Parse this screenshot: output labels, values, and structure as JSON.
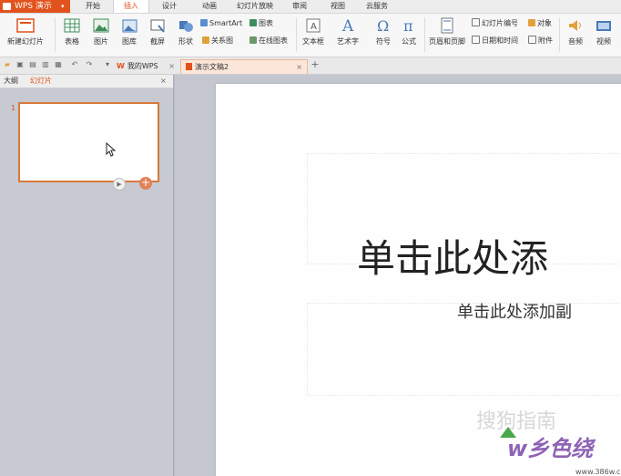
{
  "app": {
    "name": "WPS 演示"
  },
  "menu": [
    "开始",
    "插入",
    "设计",
    "动画",
    "幻灯片放映",
    "审阅",
    "视图",
    "云服务"
  ],
  "menu_active": "插入",
  "ribbon": {
    "new_slide": "新建幻灯片",
    "table": "表格",
    "picture": "图片",
    "gallery": "图库",
    "screenshot": "截屏",
    "shape": "形状",
    "smartart": "SmartArt",
    "chart": "图表",
    "relation": "关系图",
    "online_chart": "在线图表",
    "textbox": "文本框",
    "wordart": "艺术字",
    "symbol": "符号",
    "formula": "公式",
    "header_footer": "页眉和页脚",
    "slide_number": "幻灯片编号",
    "object": "对象",
    "datetime": "日期和时间",
    "attachment": "附件",
    "audio": "音频",
    "video": "视频"
  },
  "tabs": {
    "my_wps": "我的WPS",
    "doc": "演示文稿2"
  },
  "panel": {
    "outline_tab": "大纲",
    "slides_tab": "幻灯片",
    "thumb_number": "1"
  },
  "slide": {
    "title": "单击此处添",
    "subtitle": "单击此处添加副"
  },
  "watermark": {
    "line1": "搜狗指南",
    "line2": "w乡色绕",
    "line3": "www.386w.com"
  },
  "colors": {
    "accent": "#e2521c",
    "selection": "#d8793a"
  }
}
